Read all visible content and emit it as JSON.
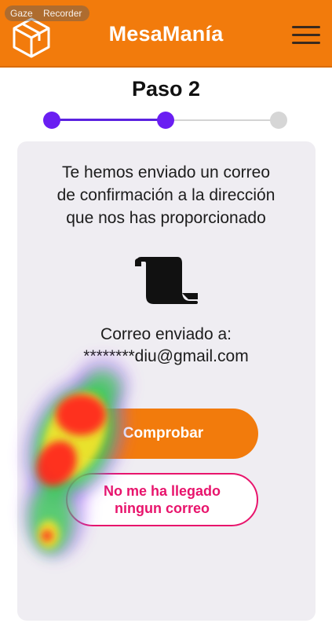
{
  "header": {
    "app_title": "MesaManía",
    "logo_icon": "box-logo-icon",
    "menu_icon": "hamburger-menu-icon",
    "background_color": "#f27b0c"
  },
  "recorder_overlay": {
    "label": "Gaze    Recorder"
  },
  "steps": {
    "title": "Paso 2",
    "current": 2,
    "total": 3,
    "active_color": "#6a1ef2",
    "inactive_color": "#d6d6d6"
  },
  "card": {
    "message": "Te hemos enviado un correo\nde confirmación a la dirección\nque nos has proporcionado",
    "icon": "document-scroll-icon",
    "sent_label": "Correo enviado a:",
    "sent_email": "********diu@gmail.com",
    "primary_button": "Comprobar",
    "secondary_button": "No me ha llegado\nningun correo"
  },
  "colors": {
    "accent": "#f27b0c",
    "secondary_accent": "#e8146c",
    "card_background": "#efedf2"
  }
}
